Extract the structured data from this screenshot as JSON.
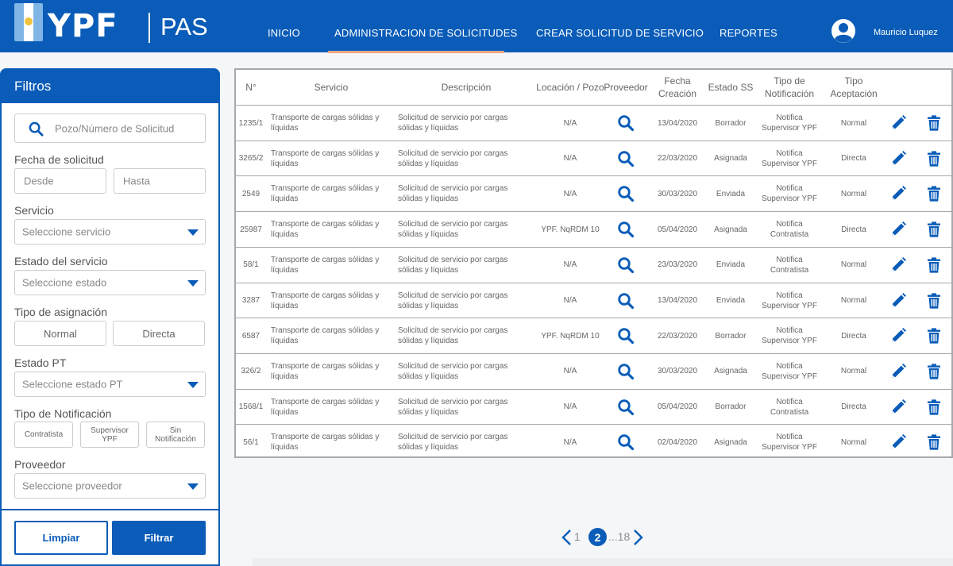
{
  "header": {
    "logo_text": "YPF",
    "app_name": "PAS",
    "nav": [
      "INICIO",
      "ADMINISTRACION DE SOLICITUDES",
      "CREAR SOLICITUD DE SERVICIO",
      "REPORTES"
    ],
    "active_nav": "ADMINISTRACION DE SOLICITUDES",
    "user_name": "Mauricio Luquez"
  },
  "filters": {
    "title": "Filtros",
    "search_placeholder": "Pozo/Número de Solicitud",
    "fecha_label": "Fecha de solicitud",
    "desde_placeholder": "Desde",
    "hasta_placeholder": "Hasta",
    "servicio_label": "Servicio",
    "servicio_placeholder": "Seleccione servicio",
    "estado_servicio_label": "Estado del servicio",
    "estado_servicio_placeholder": "Seleccione estado",
    "tipo_asignacion_label": "Tipo de asignación",
    "asignacion_options": [
      "Normal",
      "Directa"
    ],
    "estado_pt_label": "Estado PT",
    "estado_pt_placeholder": "Seleccione estado PT",
    "tipo_notificacion_label": "Tipo de Notificación",
    "notificacion_options": [
      "Contratista",
      "Supervisor YPF",
      "Sin Notificación"
    ],
    "proveedor_label": "Proveedor",
    "proveedor_placeholder": "Seleccione proveedor",
    "clear_button": "Limpiar",
    "filter_button": "Filtrar"
  },
  "table": {
    "headers": [
      "N°",
      "Servicio",
      "Descripción",
      "Locación / Pozo",
      "Proveedor",
      "Fecha Creación",
      "Estado SS",
      "Tipo de Notificación",
      "Tipo Aceptación"
    ],
    "rows": [
      {
        "num": "1235/1",
        "servicio": "Transporte de cargas sólidas y líquidas",
        "descripcion": "Solicitud de servicio por cargas sólidas y líquidas",
        "locacion": "N/A",
        "fecha": "13/04/2020",
        "estado": "Borrador",
        "notificacion": "Notifica Supervisor YPF",
        "aceptacion": "Normal"
      },
      {
        "num": "3265/2",
        "servicio": "Transporte de cargas sólidas y líquidas",
        "descripcion": "Solicitud de servicio por cargas sólidas y líquidas",
        "locacion": "N/A",
        "fecha": "22/03/2020",
        "estado": "Asignada",
        "notificacion": "Notifica Supervisor YPF",
        "aceptacion": "Directa"
      },
      {
        "num": "2549",
        "servicio": "Transporte de cargas sólidas y líquidas",
        "descripcion": "Solicitud de servicio por cargas sólidas y líquidas",
        "locacion": "N/A",
        "fecha": "30/03/2020",
        "estado": "Enviada",
        "notificacion": "Notifica Supervisor YPF",
        "aceptacion": "Normal"
      },
      {
        "num": "25987",
        "servicio": "Transporte de cargas sólidas y líquidas",
        "descripcion": "Solicitud de servicio por cargas sólidas y líquidas",
        "locacion": "YPF. NqRDM 10",
        "fecha": "05/04/2020",
        "estado": "Asignada",
        "notificacion": "Notifica Contratista",
        "aceptacion": "Directa"
      },
      {
        "num": "58/1",
        "servicio": "Transporte de cargas sólidas y líquidas",
        "descripcion": "Solicitud de servicio por cargas sólidas y líquidas",
        "locacion": "N/A",
        "fecha": "23/03/2020",
        "estado": "Enviada",
        "notificacion": "Notifica Contratista",
        "aceptacion": "Normal"
      },
      {
        "num": "3287",
        "servicio": "Transporte de cargas sólidas y líquidas",
        "descripcion": "Solicitud de servicio por cargas sólidas y líquidas",
        "locacion": "N/A",
        "fecha": "13/04/2020",
        "estado": "Enviada",
        "notificacion": "Notifica Supervisor YPF",
        "aceptacion": "Normal"
      },
      {
        "num": "6587",
        "servicio": "Transporte de cargas sólidas y líquidas",
        "descripcion": "Solicitud de servicio por cargas sólidas y líquidas",
        "locacion": "YPF. NqRDM 10",
        "fecha": "22/03/2020",
        "estado": "Borrador",
        "notificacion": "Notifica Supervisor YPF",
        "aceptacion": "Directa"
      },
      {
        "num": "326/2",
        "servicio": "Transporte de cargas sólidas y líquidas",
        "descripcion": "Solicitud de servicio por cargas sólidas y líquidas",
        "locacion": "N/A",
        "fecha": "30/03/2020",
        "estado": "Asignada",
        "notificacion": "Notifica Supervisor YPF",
        "aceptacion": "Normal"
      },
      {
        "num": "1568/1",
        "servicio": "Transporte de cargas sólidas y líquidas",
        "descripcion": "Solicitud de servicio por cargas sólidas y líquidas",
        "locacion": "N/A",
        "fecha": "05/04/2020",
        "estado": "Borrador",
        "notificacion": "Notifica Contratista",
        "aceptacion": "Directa"
      },
      {
        "num": "56/1",
        "servicio": "Transporte de cargas sólidas y líquidas",
        "descripcion": "Solicitud de servicio por cargas sólidas y líquidas",
        "locacion": "N/A",
        "fecha": "02/04/2020",
        "estado": "Asignada",
        "notificacion": "Notifica Supervisor YPF",
        "aceptacion": "Normal"
      }
    ]
  },
  "pagination": {
    "first": "1",
    "current": "2",
    "ellipsis_last": "...18"
  },
  "colors": {
    "brand_blue": "#0a5cb8",
    "nav_underline": "#e8a785"
  }
}
